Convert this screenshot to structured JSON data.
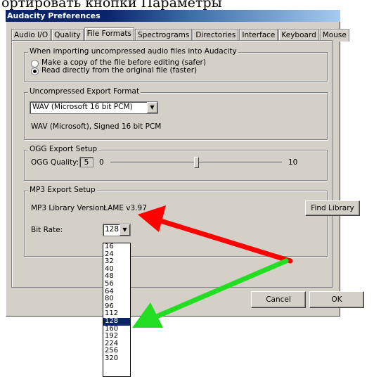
{
  "caption": "ортировать кнопки Параметры",
  "window": {
    "title": "Audacity Preferences"
  },
  "tabs": [
    {
      "label": "Audio I/O",
      "active": false
    },
    {
      "label": "Quality",
      "active": false
    },
    {
      "label": "File Formats",
      "active": true
    },
    {
      "label": "Spectrograms",
      "active": false
    },
    {
      "label": "Directories",
      "active": false
    },
    {
      "label": "Interface",
      "active": false
    },
    {
      "label": "Keyboard",
      "active": false
    },
    {
      "label": "Mouse",
      "active": false
    }
  ],
  "import_group": {
    "legend": "When importing uncompressed audio files into Audacity",
    "option_copy": "Make a copy of the file before editing (safer)",
    "option_direct": "Read directly from the original file (faster)",
    "selected": "direct"
  },
  "export_group": {
    "legend": "Uncompressed Export Format",
    "format_value": "WAV (Microsoft 16 bit PCM)",
    "format_description": "WAV (Microsoft), Signed 16 bit PCM"
  },
  "ogg_group": {
    "legend": "OGG Export Setup",
    "quality_label": "OGG Quality:",
    "quality_value": "5",
    "slider_min": "0",
    "slider_max": "10",
    "slider_value": 5
  },
  "mp3_group": {
    "legend": "MP3 Export Setup",
    "library_label": "MP3 Library Version:",
    "library_value": "LAME v3.97",
    "find_library_label": "Find Library",
    "bitrate_label": "Bit Rate:",
    "bitrate_value": "128",
    "bitrate_options": [
      "16",
      "24",
      "32",
      "40",
      "48",
      "56",
      "64",
      "80",
      "96",
      "112",
      "128",
      "160",
      "192",
      "224",
      "256",
      "320"
    ]
  },
  "buttons": {
    "cancel": "Cancel",
    "ok": "OK"
  },
  "annotations": {
    "arrow_red_color": "#ff0000",
    "arrow_green_color": "#22dd22"
  },
  "colors": {
    "dialog_bg": "#d4d0c8",
    "selection": "#0a246a"
  }
}
